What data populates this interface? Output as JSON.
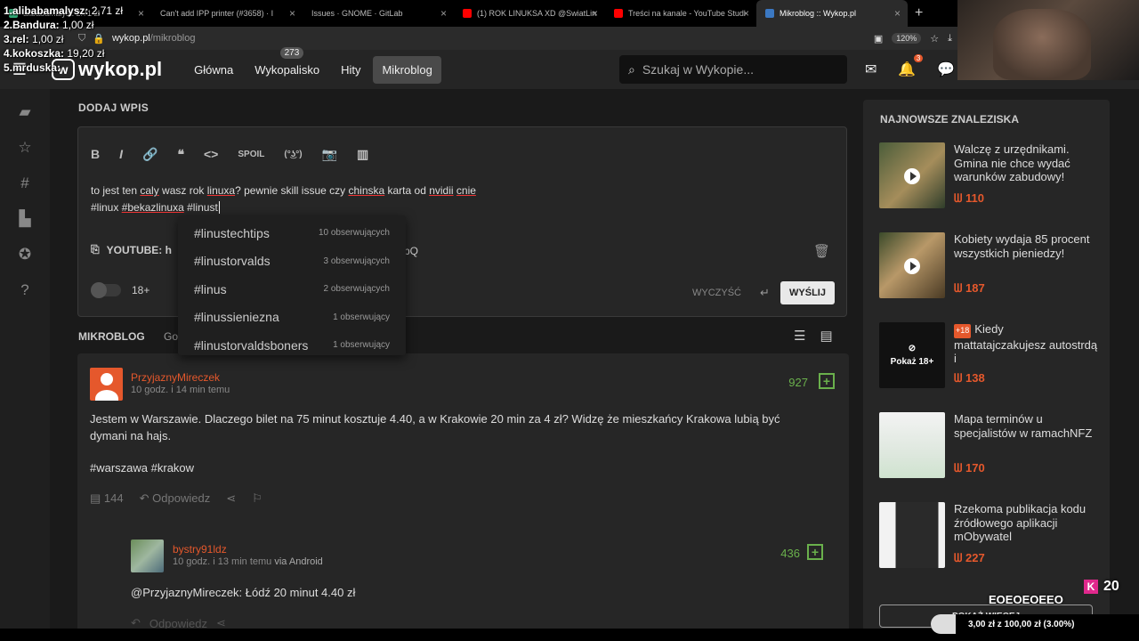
{
  "browser": {
    "tabs": [
      {
        "title": "alibabamalysz 2.71 zł",
        "fav": "#3a7"
      },
      {
        "title": "Can't add IPP printer (#3658) · I",
        "fav": "#888"
      },
      {
        "title": "Issues · GNOME · GitLab",
        "fav": "#e24329"
      },
      {
        "title": "(1) ROK LINUKSA XD @SwiatLin",
        "fav": "#f00"
      },
      {
        "title": "Treści na kanale - YouTube Studi",
        "fav": "#f00"
      },
      {
        "title": "Mikroblog :: Wykop.pl",
        "fav": "#3b78c2"
      }
    ],
    "new_tab": "+",
    "url_domain": "wykop.pl",
    "url_path": "/mikroblog",
    "zoom": "120%"
  },
  "header": {
    "logo": "wykop.pl",
    "nav": [
      "Główna",
      "Wykopalisko",
      "Hity",
      "Mikroblog"
    ],
    "wykopalisko_badge": "273",
    "search_placeholder": "Szukaj w Wykopie...",
    "notif_count": "3"
  },
  "editor": {
    "title": "DODAJ WPIS",
    "toolbar": [
      "B",
      "I",
      "🔗",
      "❝",
      "<>",
      "SPOIL",
      "(°͜ʖ°)",
      "📷",
      "▥"
    ],
    "line1_pre": "to jest ten ",
    "w_caly": "caly",
    "line1_mid": " wasz rok ",
    "w_linuxa": "linuxa",
    "line1_mid2": "? pewnie skill issue czy ",
    "w_chinska": "chinska",
    "line1_mid3": " karta od ",
    "w_nvidii": "nvidii",
    "line1_mid4": " ",
    "w_cnie": "cnie",
    "line2_a": "#linux",
    "line2_sp1": " ",
    "line2_b": "#bekazlinuxa",
    "line2_sp2": " ",
    "line2_c": "#linust",
    "yt_label": "YOUTUBE: h",
    "yt_tail": "pQ",
    "adult_label": "18+",
    "clear_label": "WYCZYŚĆ",
    "send_label": "WYŚLIJ"
  },
  "suggestions": [
    {
      "tag": "#linustechtips",
      "count": "10 obserwujących"
    },
    {
      "tag": "#linustorvalds",
      "count": "3 obserwujących"
    },
    {
      "tag": "#linus",
      "count": "2 obserwujących"
    },
    {
      "tag": "#linussieniezna",
      "count": "1 obserwujący"
    },
    {
      "tag": "#linustorvaldsboners",
      "count": "1 obserwujący"
    }
  ],
  "feed": {
    "title": "MIKROBLOG",
    "sub": "Go",
    "entry": {
      "author": "PrzyjaznyMireczek",
      "time": "10 godz. i 14 min temu",
      "votes": "927",
      "body": "Jestem w Warszawie. Dlaczego bilet na 75 minut kosztuje 4.40, a w Krakowie 20 min za 4 zł? Widzę że mieszkańcy Krakowa lubią być dymani na hajs.",
      "tags": "#warszawa #krakow",
      "comments": "144",
      "reply_label": "Odpowiedz"
    },
    "reply": {
      "author": "bystry91ldz",
      "time": "10 godz. i 13 min temu",
      "via": "via Android",
      "votes": "436",
      "body": "@PrzyjaznyMireczek: Łódź 20 minut 4.40 zł",
      "reply_label": "Odpowiedz"
    }
  },
  "sidebar": {
    "title": "NAJNOWSZE ZNALEZISKA",
    "items": [
      {
        "title": "Walczę z urzędnikami. Gmina nie chce wydać warunków zabudowy!",
        "score": "110"
      },
      {
        "title": "Kobiety wydaja 85 procent wszystkich pieniedzy!",
        "score": "187"
      },
      {
        "badge": "+18",
        "title": "Kiedy mattatajczakujesz autostrdą i",
        "score": "138",
        "nsfw_label": "Pokaż 18+"
      },
      {
        "title": "Mapa terminów u specjalistów w ramachNFZ",
        "score": "170"
      },
      {
        "title": "Rzekoma publikacja kodu źródłowego aplikacji mObywatel",
        "score": "227"
      }
    ],
    "more": "POKAŻ WIĘCEJ"
  },
  "overlay": {
    "leaders": [
      {
        "name": "1.alibabamalysz:",
        "amt": " 2,71 zł"
      },
      {
        "name": "2.Bandura:",
        "amt": " 1,00 zł"
      },
      {
        "name": "3.rel:",
        "amt": " 1,00 zł"
      },
      {
        "name": "4.kokoszka:",
        "amt": " 19,20 zł"
      },
      {
        "name": "5.mrduska:",
        "amt": " "
      }
    ],
    "kick_count": "20",
    "goal_title": "EOEOEOEEO",
    "goal_text": "3,00 zł z 100,00 zł (3.00%)",
    "goal_progress": 0.03
  },
  "colors": {
    "accent": "#e5582c",
    "vote": "#6ab04c"
  }
}
